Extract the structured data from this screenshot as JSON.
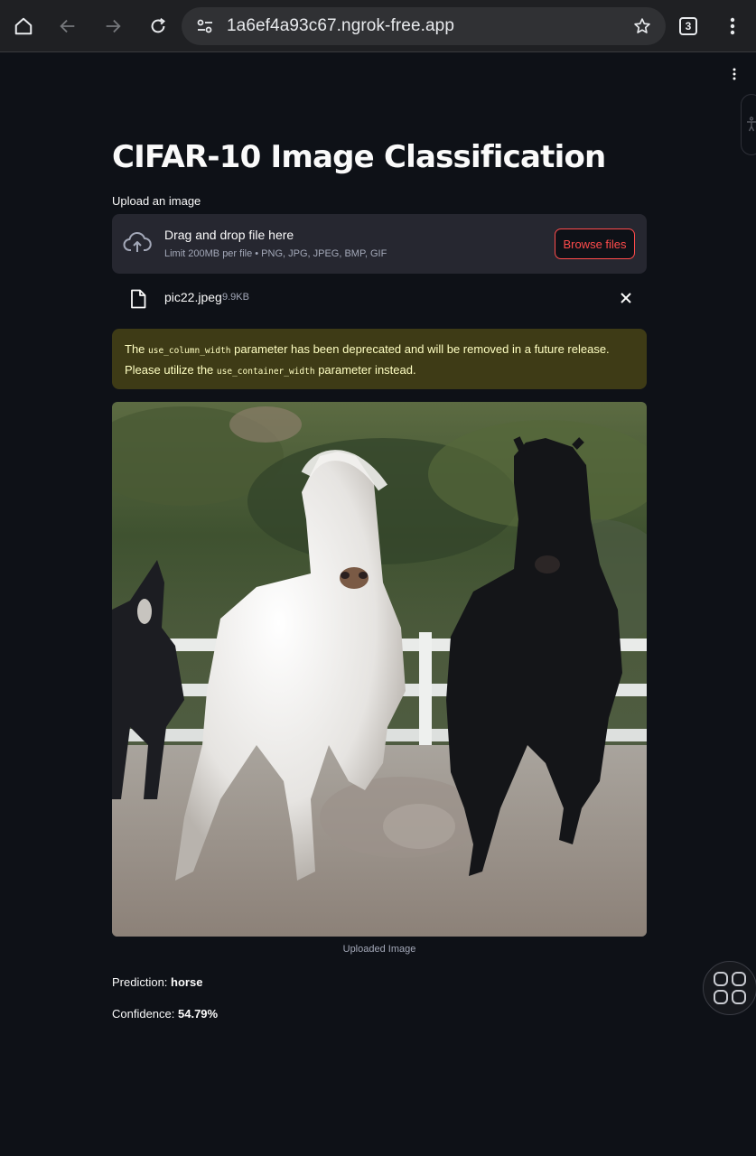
{
  "browser": {
    "url": "1a6ef4a93c67.ngrok-free.app",
    "tab_count": "3"
  },
  "app": {
    "title": "CIFAR-10 Image Classification",
    "upload_label": "Upload an image",
    "dropzone": {
      "title": "Drag and drop file here",
      "subtitle": "Limit 200MB per file • PNG, JPG, JPEG, BMP, GIF",
      "browse_label": "Browse files"
    },
    "file": {
      "name": "pic22.jpeg",
      "size": "9.9KB"
    },
    "warning": {
      "text_1": "The ",
      "code_1": "use_column_width",
      "text_2": " parameter has been deprecated and will be removed in a future release. Please utilize the ",
      "code_2": "use_container_width",
      "text_3": " parameter instead."
    },
    "image_caption": "Uploaded Image",
    "prediction": {
      "label": "Prediction: ",
      "value": "horse"
    },
    "confidence": {
      "label": "Confidence: ",
      "value": "54.79%"
    }
  },
  "colors": {
    "background": "#0e1117",
    "accent": "#ff4b4b",
    "warning_bg": "#3e3b16",
    "warning_text": "#ffffc2"
  }
}
